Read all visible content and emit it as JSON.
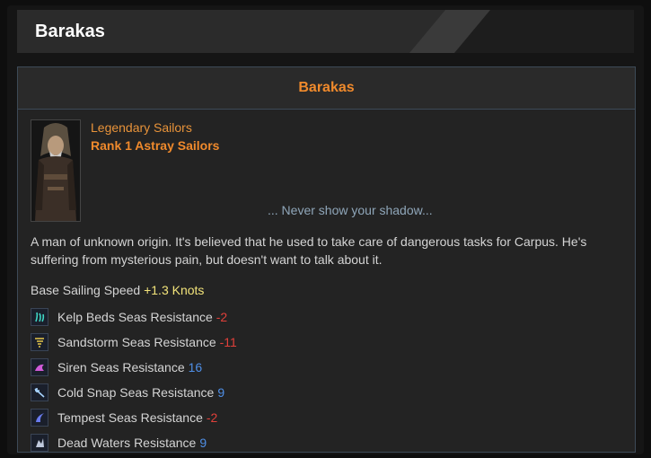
{
  "header": {
    "title": "Barakas"
  },
  "panel": {
    "title": "Barakas",
    "class_line": "Legendary Sailors",
    "rank_line": "Rank 1 Astray Sailors",
    "quote": "... Never show your shadow...",
    "description": "A man of unknown origin. It's believed that he used to take care of dangerous tasks for Carpus. He's suffering from mysterious pain, but doesn't want to talk about it.",
    "speed_label": "Base Sailing Speed",
    "speed_value": "+1.3 Knots",
    "resistances": [
      {
        "label": "Kelp Beds Seas Resistance",
        "value": "-2",
        "icon": "kelp-icon",
        "color": "#3fd7c6"
      },
      {
        "label": "Sandstorm Seas Resistance",
        "value": "-11",
        "icon": "sandstorm-icon",
        "color": "#e7c84a"
      },
      {
        "label": "Siren Seas Resistance",
        "value": "16",
        "icon": "siren-icon",
        "color": "#d05ad8"
      },
      {
        "label": "Cold Snap Seas Resistance",
        "value": "9",
        "icon": "cold-snap-icon",
        "color": "#a8d4ff"
      },
      {
        "label": "Tempest Seas Resistance",
        "value": "-2",
        "icon": "tempest-icon",
        "color": "#6a7cf0"
      },
      {
        "label": "Dead Waters Resistance",
        "value": "9",
        "icon": "dead-waters-icon",
        "color": "#bfc9dc"
      }
    ]
  }
}
